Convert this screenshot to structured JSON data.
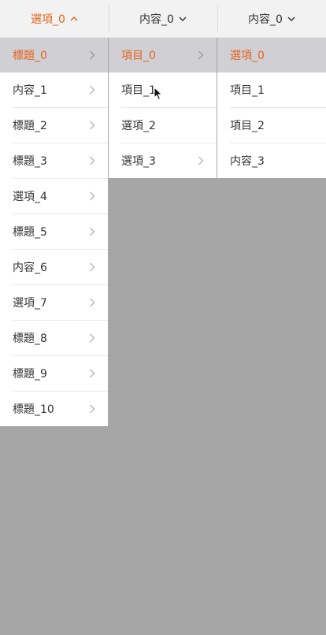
{
  "tabs": [
    {
      "label": "選項_0",
      "active": true
    },
    {
      "label": "内容_0",
      "active": false
    },
    {
      "label": "内容_0",
      "active": false
    }
  ],
  "columns": {
    "col1": [
      {
        "label": "標題_0",
        "selected": true
      },
      {
        "label": "内容_1"
      },
      {
        "label": "標題_2"
      },
      {
        "label": "標題_3"
      },
      {
        "label": "選項_4"
      },
      {
        "label": "標題_5"
      },
      {
        "label": "内容_6"
      },
      {
        "label": "選項_7"
      },
      {
        "label": "標題_8"
      },
      {
        "label": "標題_9"
      },
      {
        "label": "標題_10"
      }
    ],
    "col2": [
      {
        "label": "項目_0",
        "selected": true
      },
      {
        "label": "項目_1"
      },
      {
        "label": "選項_2"
      },
      {
        "label": "選項_3"
      }
    ],
    "col3": [
      {
        "label": "選項_0",
        "selected": true
      },
      {
        "label": "項目_1"
      },
      {
        "label": "項目_2"
      },
      {
        "label": "内容_3"
      }
    ]
  },
  "icons": {
    "tab_active_chevron": "chevron-up-icon",
    "tab_chevron": "chevron-down-icon",
    "item_arrow": "chevron-right-icon"
  },
  "colors": {
    "accent": "#e8631b",
    "selected_bg": "#cfcfd4",
    "overlay": "#a6a6a6",
    "text": "#333333"
  }
}
